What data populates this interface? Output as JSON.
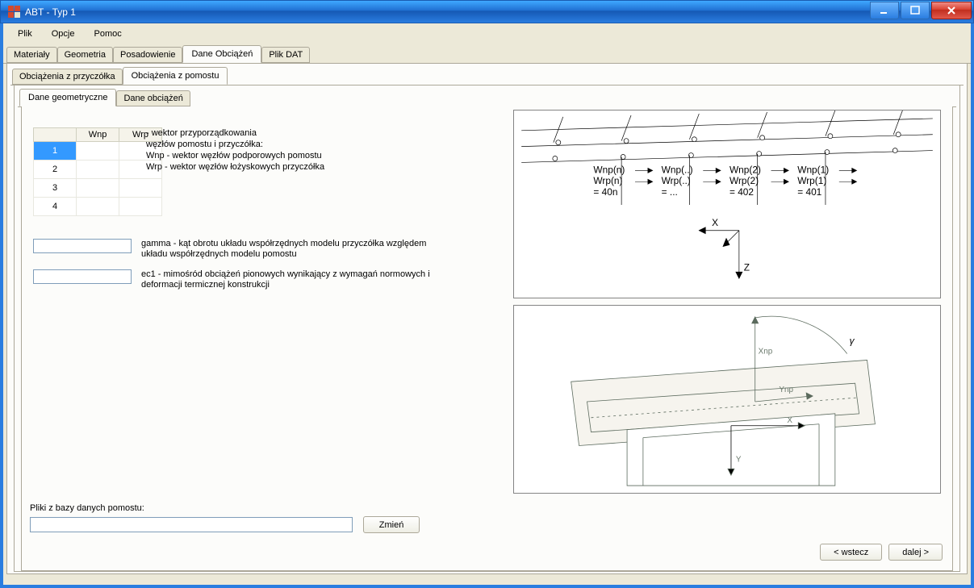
{
  "window": {
    "title": "ABT - Typ 1"
  },
  "menu": {
    "file": "Plik",
    "options": "Opcje",
    "help": "Pomoc"
  },
  "tabs_main": {
    "materialy": "Materiały",
    "geometria": "Geometria",
    "posadowienie": "Posadowienie",
    "dane_obciazen": "Dane Obciążeń",
    "plik_dat": "Plik DAT",
    "active": "dane_obciazen"
  },
  "tabs_sub1": {
    "obc_przyczolka": "Obciążenia z przyczółka",
    "obc_pomostu": "Obciążenia z pomostu",
    "active": "obc_pomostu"
  },
  "tabs_sub2": {
    "dane_geom": "Dane geometryczne",
    "dane_obc": "Dane obciążeń",
    "active": "dane_geom"
  },
  "table": {
    "col_wnp": "Wnp",
    "col_wrp": "Wrp",
    "rows": [
      {
        "idx": "1",
        "wnp": "",
        "wrp": "",
        "selected": true
      },
      {
        "idx": "2",
        "wnp": "",
        "wrp": "",
        "selected": false
      },
      {
        "idx": "3",
        "wnp": "",
        "wrp": "",
        "selected": false
      },
      {
        "idx": "4",
        "wnp": "",
        "wrp": "",
        "selected": false
      }
    ]
  },
  "descriptions": {
    "vec1": "- wektor przyporządkowania",
    "vec2": "węzłów pomostu i przyczółka:",
    "vec3": "Wnp - wektor węzłów podporowych pomostu",
    "vec4": "Wrp - wektor węzłów łożyskowych przyczółka",
    "gamma": "gamma - kąt obrotu układu współrzędnych modelu przyczółka względem układu współrzędnych modelu pomostu",
    "ec1": "ec1 - mimośród obciążeń pionowych wynikający z wymagań normowych i deformacji termicznej konstrukcji"
  },
  "inputs": {
    "gamma": "",
    "ec1": "",
    "filepath": ""
  },
  "labels": {
    "files": "Pliki z bazy danych pomostu:",
    "change": "Zmień",
    "back": "< wstecz",
    "next": "dalej >"
  },
  "diagram1": {
    "cols": [
      {
        "wnp": "Wnp(n)",
        "wrp": "Wrp(n)",
        "eq": "= 40n"
      },
      {
        "wnp": "Wnp(..)",
        "wrp": "Wrp(..)",
        "eq": "= ..."
      },
      {
        "wnp": "Wnp(2)",
        "wrp": "Wrp(2)",
        "eq": "= 402"
      },
      {
        "wnp": "Wnp(1)",
        "wrp": "Wrp(1)",
        "eq": "= 401"
      }
    ],
    "axis_x": "X",
    "axis_z": "Z"
  },
  "diagram2": {
    "gamma": "γ",
    "xnp": "Xnp",
    "ynp": "Ynp",
    "x": "X",
    "y": "Y"
  }
}
